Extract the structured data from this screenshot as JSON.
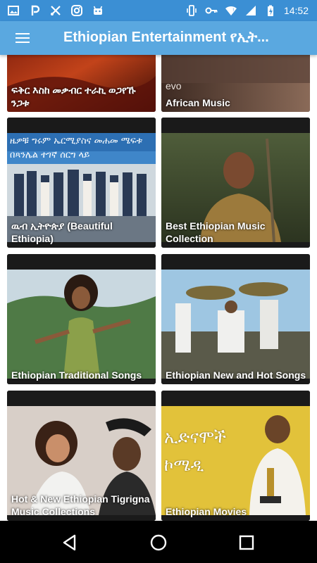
{
  "status_bar": {
    "time": "14:52",
    "icons_left": [
      "gallery-icon",
      "pinterest-icon",
      "tools-icon",
      "instagram-icon",
      "android-icon"
    ],
    "icons_right": [
      "vibrate-icon",
      "key-icon",
      "wifi-icon",
      "signal-icon",
      "battery-charging-icon"
    ]
  },
  "app_bar": {
    "menu_icon": "hamburger-menu-icon",
    "title": "Ethiopian Entertainment የኢት..."
  },
  "cards": [
    {
      "label": "ፍቅር እስከ መቃብር ተራኪ ወጋየኹ ንጋቱ"
    },
    {
      "label": "African Music",
      "overlay_text": "evo"
    },
    {
      "label": "ዉብ ኢትዮጵያ (Beautiful Ethiopia)",
      "banner_text": "ዜዎቹ ግሩም ኤርሚያስና መሐመ ሜፍቱ በጻንሌል ተገኛ ሰርግ ላይ"
    },
    {
      "label": "Best Ethiopian Music Collection"
    },
    {
      "label": "Ethiopian Traditional Songs"
    },
    {
      "label": "Ethiopian New and Hot Songs"
    },
    {
      "label": "Hot & New Ethiopian Tigrigna Music Collections"
    },
    {
      "label": "Ethiopian Movies",
      "banner_text": "ኢድናሞች ኮሜዲ"
    }
  ],
  "nav_bar": {
    "back_icon": "back-triangle-icon",
    "home_icon": "home-circle-icon",
    "recents_icon": "recents-square-icon"
  },
  "colors": {
    "status_bar": "#3b8fd4",
    "app_bar": "#5aa8e0",
    "card_bg": "#1c1c1c",
    "nav_bar": "#000000"
  }
}
